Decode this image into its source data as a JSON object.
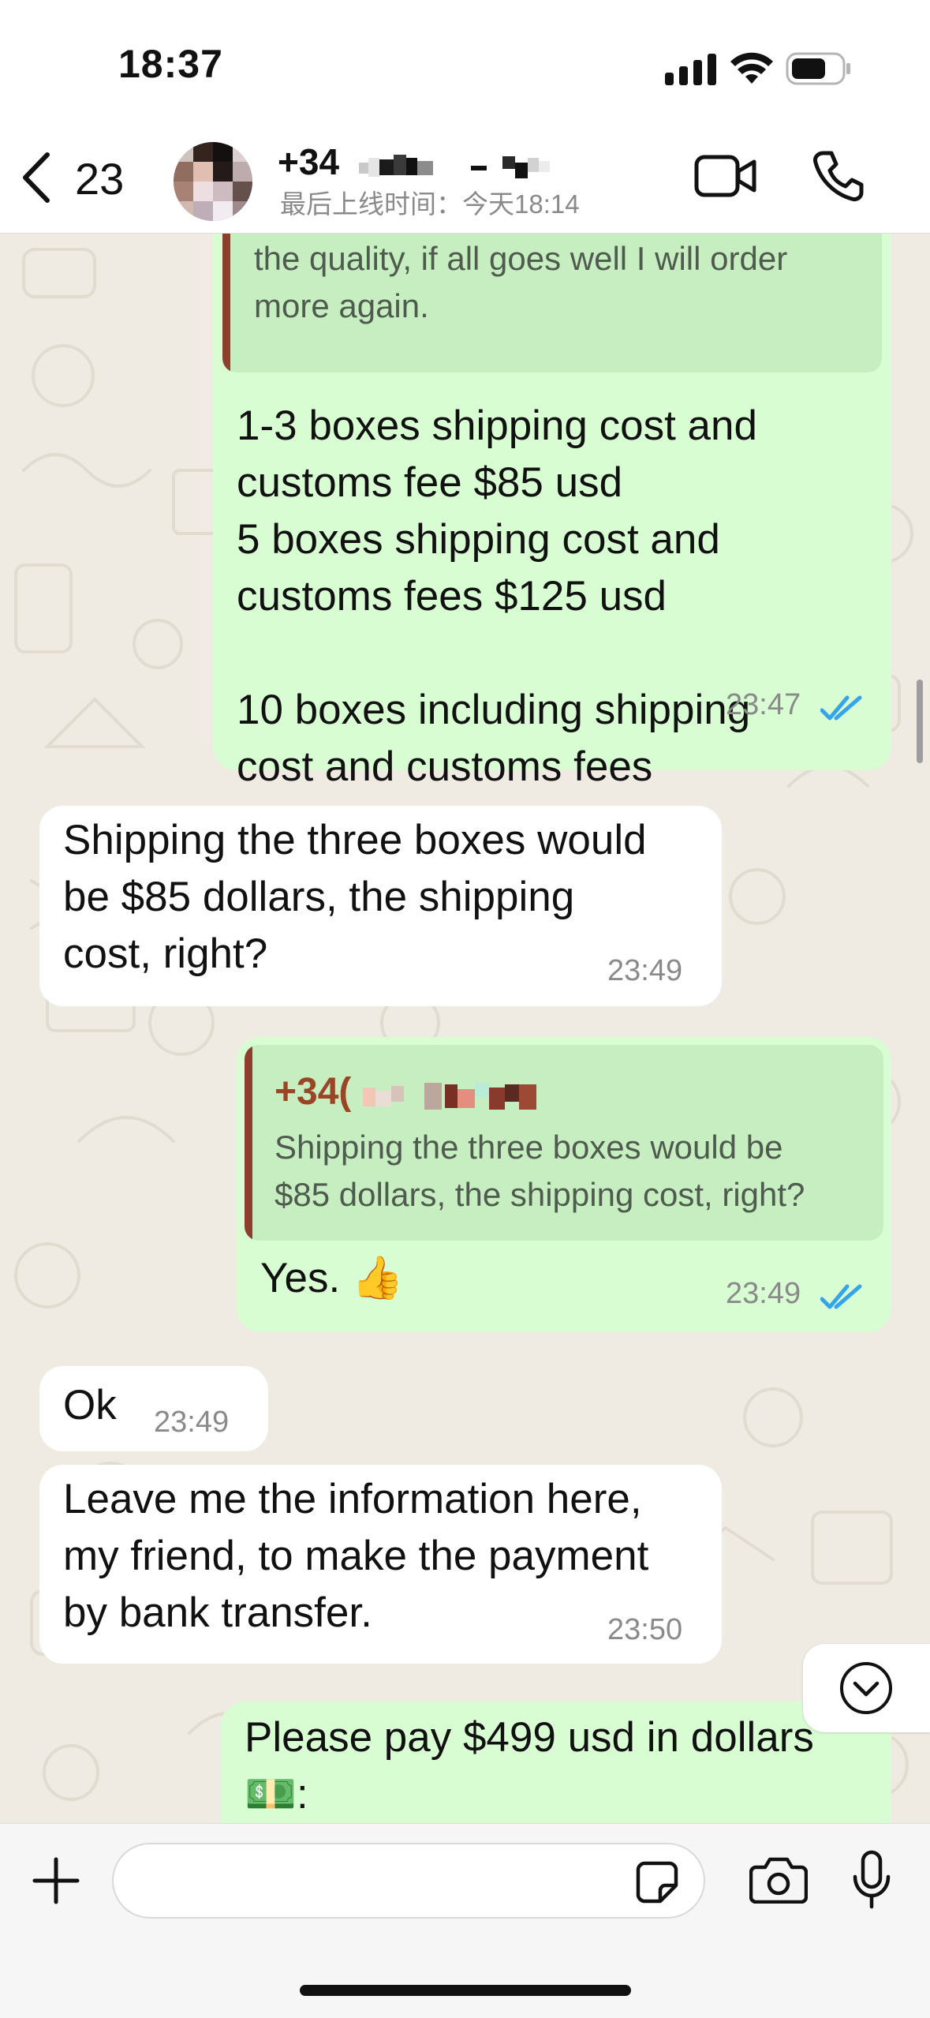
{
  "status_bar": {
    "time": "18:37",
    "signal_icon": "signal-bars-icon",
    "wifi_icon": "wifi-icon",
    "battery_icon": "battery-icon"
  },
  "header": {
    "back_count": "23",
    "contact_name": "+34",
    "last_seen": "最后上线时间：今天18:14",
    "video_icon": "video-call-icon",
    "phone_icon": "voice-call-icon"
  },
  "messages": [
    {
      "direction": "outgoing",
      "quote_text": "the quality, if all goes well I will order\nmore again.",
      "text": "1-3 boxes shipping cost and\ncustoms fee $85 usd\n5 boxes shipping cost and\ncustoms fees $125 usd\n\n10 boxes including shipping\ncost and customs fees",
      "time": "23:47",
      "status": "read"
    },
    {
      "direction": "incoming",
      "text": "Shipping the three boxes would\nbe $85 dollars, the shipping\ncost, right?",
      "time": "23:49"
    },
    {
      "direction": "outgoing",
      "quote_author": "+34(",
      "quote_text": "Shipping the three boxes would be\n$85 dollars, the shipping cost, right?",
      "text": "Yes. 👍",
      "time": "23:49",
      "status": "read"
    },
    {
      "direction": "incoming",
      "text": "Ok",
      "time": "23:49"
    },
    {
      "direction": "incoming",
      "text": "Leave me the information here,\nmy friend, to make the payment\nby bank transfer.",
      "time": "23:50"
    },
    {
      "direction": "outgoing",
      "text": "Please pay $499 usd in dollars\n💵:"
    }
  ],
  "input": {
    "placeholder": "",
    "value": ""
  },
  "colors": {
    "outgoing_bubble": "#d9fdd3",
    "incoming_bubble": "#ffffff",
    "read_tick": "#34a4eb",
    "quote_bar": "#8f3d2c",
    "quote_author": "#9b4527"
  }
}
